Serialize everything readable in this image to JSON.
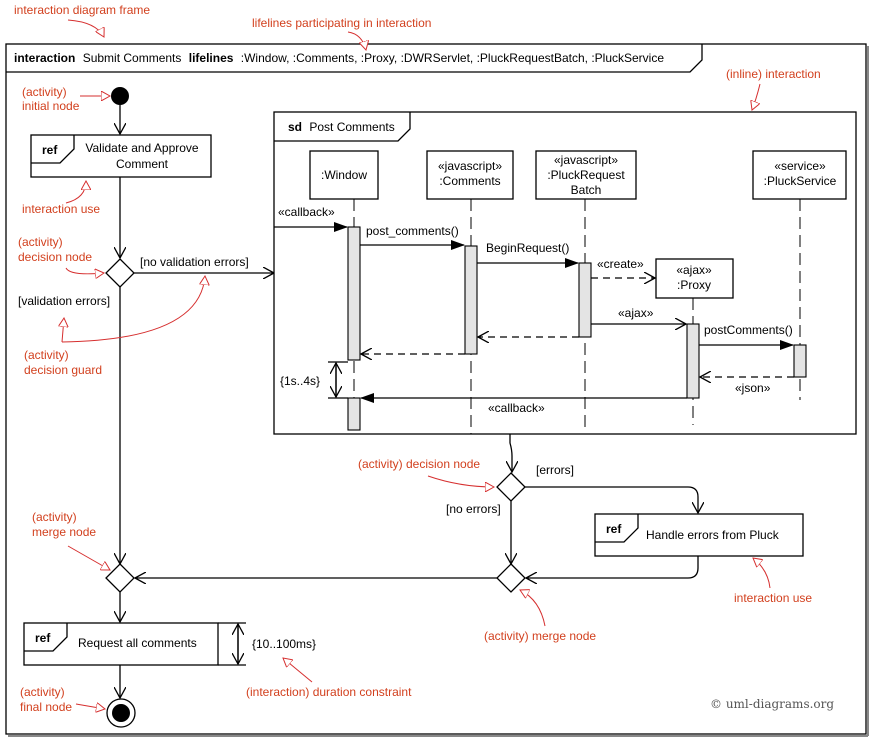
{
  "frame": {
    "keyword_interaction": "interaction",
    "name": "Submit Comments",
    "keyword_lifelines": "lifelines",
    "lifelines": ":Window, :Comments, :Proxy, :DWRServlet, :PluckRequestBatch, :PluckService"
  },
  "activity": {
    "ref_keyword": "ref",
    "validate_line1": "Validate and Approve",
    "validate_line2": "Comment",
    "guard_no_validation_errors": "[no validation errors]",
    "guard_validation_errors": "[validation errors]",
    "guard_errors": "[errors]",
    "guard_no_errors": "[no errors]",
    "handle_errors": "Handle errors from Pluck",
    "request_all": "Request all comments",
    "duration_constraint": "{10..100ms}"
  },
  "sequence": {
    "keyword": "sd",
    "name": "Post Comments",
    "lifelines": [
      {
        "stereotype": "",
        "name": ":Window"
      },
      {
        "stereotype": "«javascript»",
        "name": ":Comments"
      },
      {
        "stereotype": "«javascript»",
        "name": ":PluckRequest",
        "name2": "Batch"
      },
      {
        "stereotype": "«ajax»",
        "name": ":Proxy"
      },
      {
        "stereotype": "«service»",
        "name": ":PluckService"
      }
    ],
    "messages": {
      "callback_in": "«callback»",
      "post_comments": "post_comments()",
      "begin_request": "BeginRequest()",
      "create": "«create»",
      "ajax": "«ajax»",
      "post_comments_service": "postComments()",
      "json": "«json»",
      "callback_return": "«callback»"
    },
    "duration_constraint": "{1s..4s}"
  },
  "annotations": {
    "frame": "interaction diagram frame",
    "lifelines": "lifelines participating in interaction",
    "inline": "(inline) interaction",
    "initial_1": "(activity)",
    "initial_2": "initial node",
    "interaction_use": "interaction use",
    "decision_1": "(activity)",
    "decision_2": "decision node",
    "guard_1": "(activity)",
    "guard_2": "decision guard",
    "decision_full": "(activity) decision node",
    "merge_1": "(activity)",
    "merge_2": "merge node",
    "interaction_use_2": "interaction use",
    "merge_full": "(activity) merge node",
    "duration": "(interaction) duration constraint",
    "final_1": "(activity)",
    "final_2": "final node"
  },
  "copyright": "© uml-diagrams.org"
}
